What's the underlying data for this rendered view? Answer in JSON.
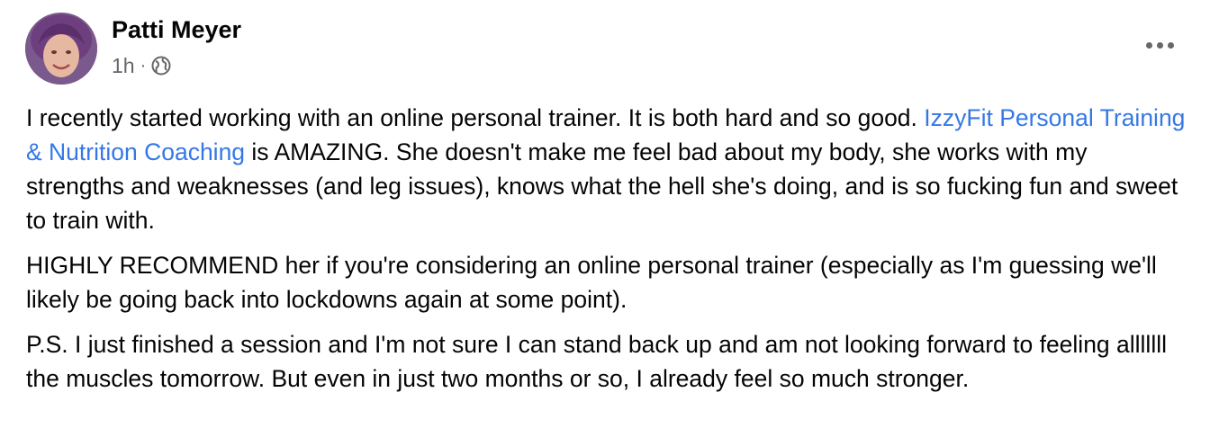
{
  "post": {
    "author_name": "Patti Meyer",
    "timestamp": "1h",
    "separator": "·",
    "privacy_icon": "globe-icon",
    "more_icon": "more-options-icon",
    "paragraphs": [
      {
        "before_link": "I recently started working with an online personal trainer. It is both hard and so good. ",
        "link_text": "IzzyFit Personal Training & Nutrition Coaching",
        "after_link": " is AMAZING. She doesn't make me feel bad about my body, she works with my strengths and weaknesses (and leg issues), knows what the hell she's doing, and is so fucking fun and sweet to train with."
      },
      {
        "text": "HIGHLY RECOMMEND her if you're considering an online personal trainer (especially as I'm guessing we'll likely be going back into lockdowns again at some point)."
      },
      {
        "text": "P.S. I just finished a session and I'm not sure I can stand back up and am not looking forward to feeling alllllll the muscles tomorrow. But even in just two months or so, I already feel so much stronger."
      }
    ]
  },
  "colors": {
    "text": "#050505",
    "secondary_text": "#65676b",
    "link": "#3578e5",
    "background": "#ffffff"
  }
}
